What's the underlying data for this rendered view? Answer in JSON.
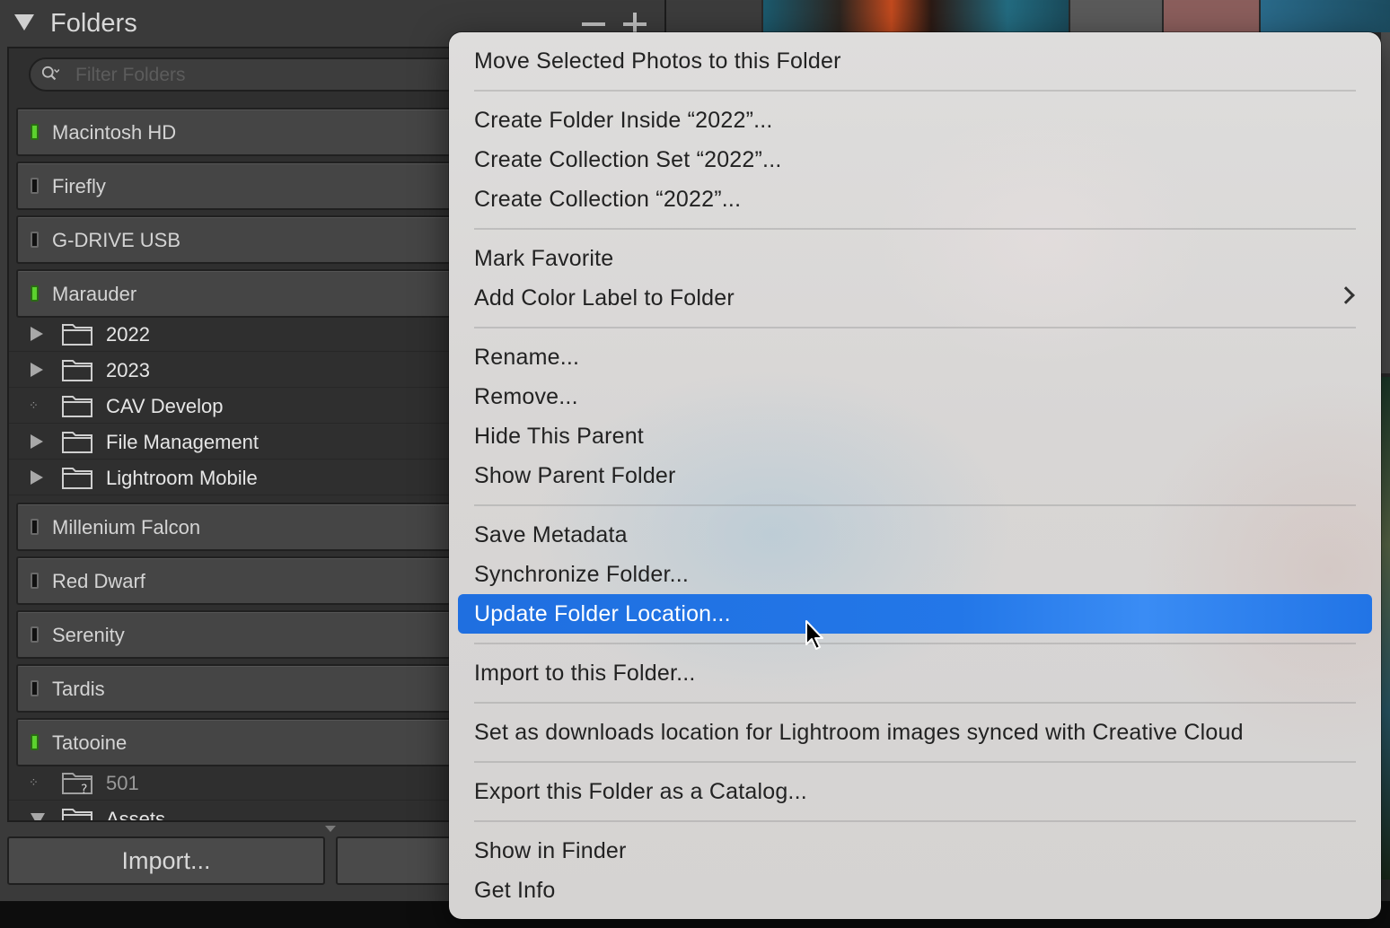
{
  "panel": {
    "title": "Folders",
    "filter_placeholder": "Filter Folders",
    "volumes": [
      {
        "name": "Macintosh HD",
        "online": true
      },
      {
        "name": "Firefly",
        "online": false
      },
      {
        "name": "G-DRIVE USB",
        "online": false
      },
      {
        "name": "Marauder",
        "online": true
      },
      {
        "name": "Millenium Falcon",
        "online": false
      },
      {
        "name": "Red Dwarf",
        "online": false
      },
      {
        "name": "Serenity",
        "online": false
      },
      {
        "name": "Tardis",
        "online": false
      },
      {
        "name": "Tatooine",
        "online": true
      }
    ],
    "marauder_folders": [
      "2022",
      "2023",
      "CAV Develop",
      "File Management",
      "Lightroom Mobile"
    ],
    "tatooine_folders": [
      "501",
      "Assets"
    ],
    "import_label": "Import..."
  },
  "menu": {
    "items": [
      "Move Selected Photos to this Folder",
      "Create Folder Inside “2022”...",
      "Create Collection Set “2022”...",
      "Create Collection “2022”...",
      "Mark Favorite",
      "Add Color Label to Folder",
      "Rename...",
      "Remove...",
      "Hide This Parent",
      "Show Parent Folder",
      "Save Metadata",
      "Synchronize Folder...",
      "Update Folder Location...",
      "Import to this Folder...",
      "Set as downloads location for Lightroom images synced with Creative Cloud",
      "Export this Folder as a Catalog...",
      "Show in Finder",
      "Get Info"
    ],
    "highlighted_item": "Update Folder Location...",
    "submenu_item": "Add Color Label to Folder"
  },
  "colors": {
    "highlight": "#2377e8",
    "led_online": "#5cd32e",
    "panel_bg": "#3a3a3a"
  }
}
